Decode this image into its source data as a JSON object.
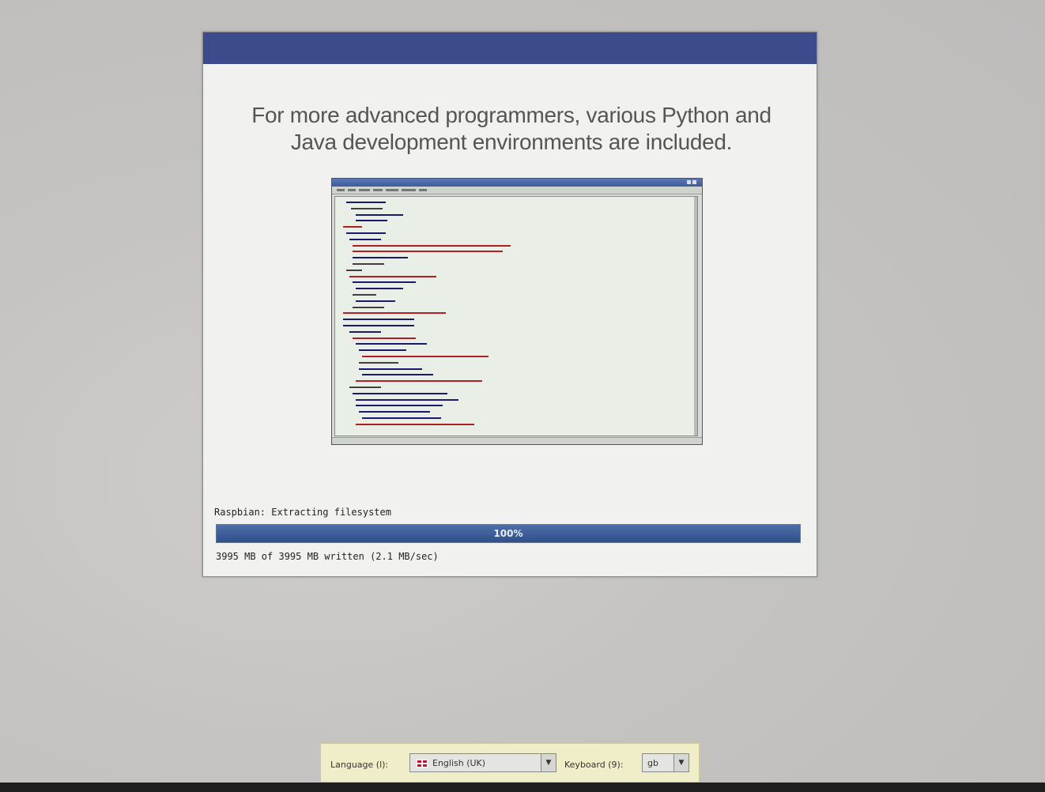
{
  "slide": {
    "title": "For more advanced programmers, various Python and Java development environments are included."
  },
  "progress": {
    "status": "Raspbian: Extracting filesystem",
    "percent_label": "100%",
    "fraction": 1.0,
    "written": "3995 MB of 3995 MB written (2.1 MB/sec)"
  },
  "footer": {
    "language_label": "Language (l):",
    "language_value": "English (UK)",
    "keyboard_label": "Keyboard (9):",
    "keyboard_value": "gb"
  },
  "colors": {
    "header_strip": "#3b4b8c",
    "progress_fill": "#30508c"
  },
  "icons": [
    "uk-flag-icon",
    "dropdown-arrow-icon"
  ]
}
